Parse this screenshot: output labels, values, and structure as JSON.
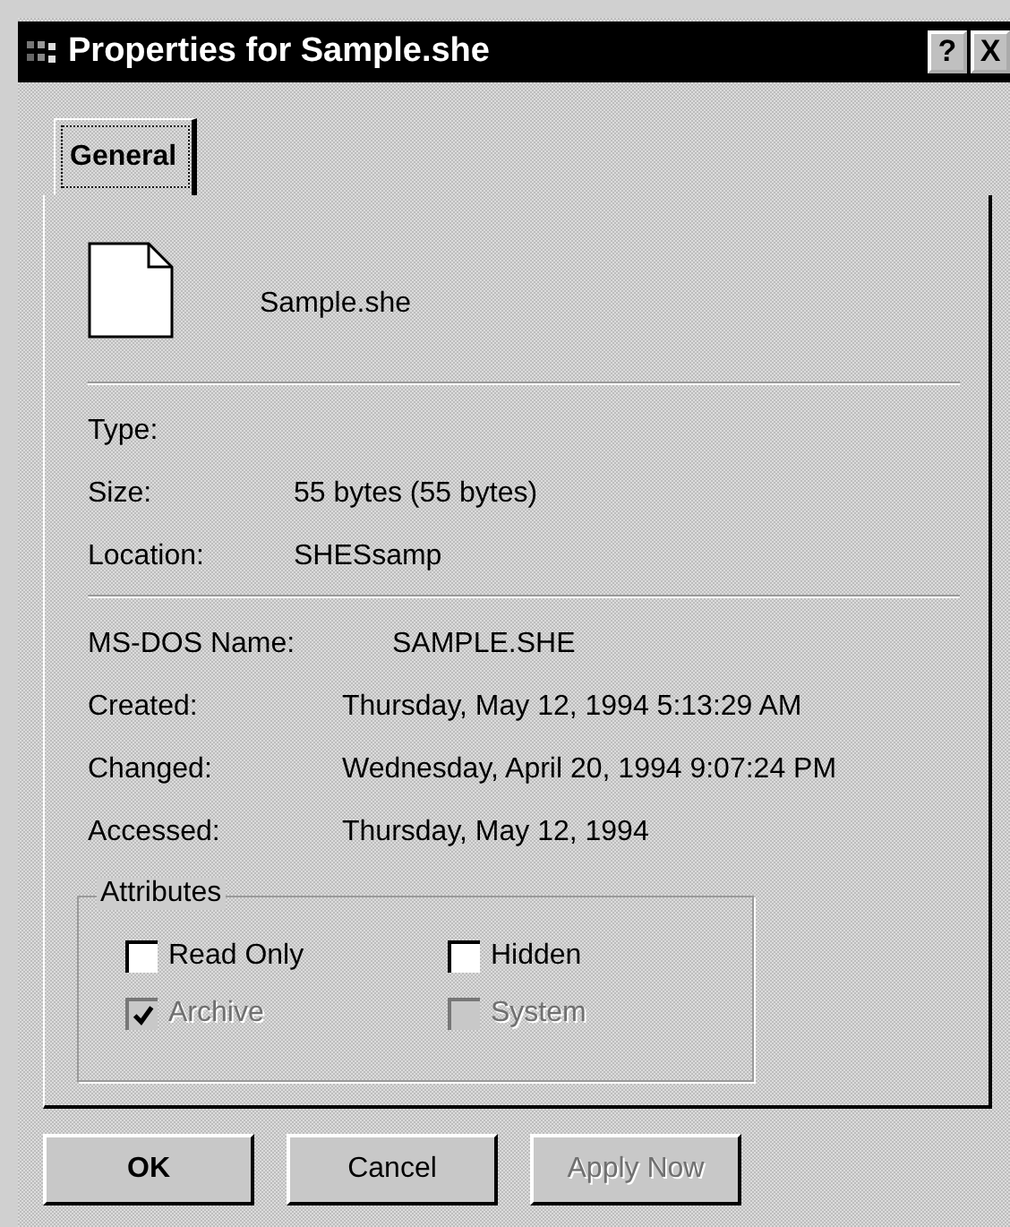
{
  "window": {
    "title": "Properties for Sample.she",
    "buttons": [
      "?",
      "X"
    ]
  },
  "tabs": [
    {
      "label": "General",
      "selected": true
    }
  ],
  "file": {
    "name": "Sample.she"
  },
  "sections": [
    {
      "rows": [
        {
          "label": "Type:"
        },
        {
          "label": "Size:",
          "value": "55 bytes (55 bytes)"
        },
        {
          "label": "Location:",
          "value": "SHESsamp"
        }
      ]
    },
    {
      "rows": [
        {
          "label": "MS-DOS Name:",
          "value": "SAMPLE.SHE",
          "kind": "wide"
        },
        {
          "label": "Created:",
          "value": "Thursday, May 12, 1994 5:13:29 AM"
        },
        {
          "label": "Changed:",
          "value": "Wednesday, April 20, 1994 9:07:24 PM"
        },
        {
          "label": "Accessed:",
          "value": "Thursday, May 12, 1994"
        }
      ]
    }
  ],
  "attributes": {
    "title": "Attributes",
    "items": [
      {
        "label": "Read Only",
        "checked": false,
        "disabled": false
      },
      {
        "label": "Hidden",
        "checked": false,
        "disabled": false
      },
      {
        "label": "Archive",
        "checked": true,
        "disabled": true
      },
      {
        "label": "System",
        "checked": false,
        "disabled": true
      }
    ]
  },
  "buttons": [
    {
      "label": "OK",
      "default": true,
      "disabled": false
    },
    {
      "label": "Cancel",
      "default": false,
      "disabled": false
    },
    {
      "label": "Apply Now",
      "default": false,
      "disabled": true
    }
  ]
}
